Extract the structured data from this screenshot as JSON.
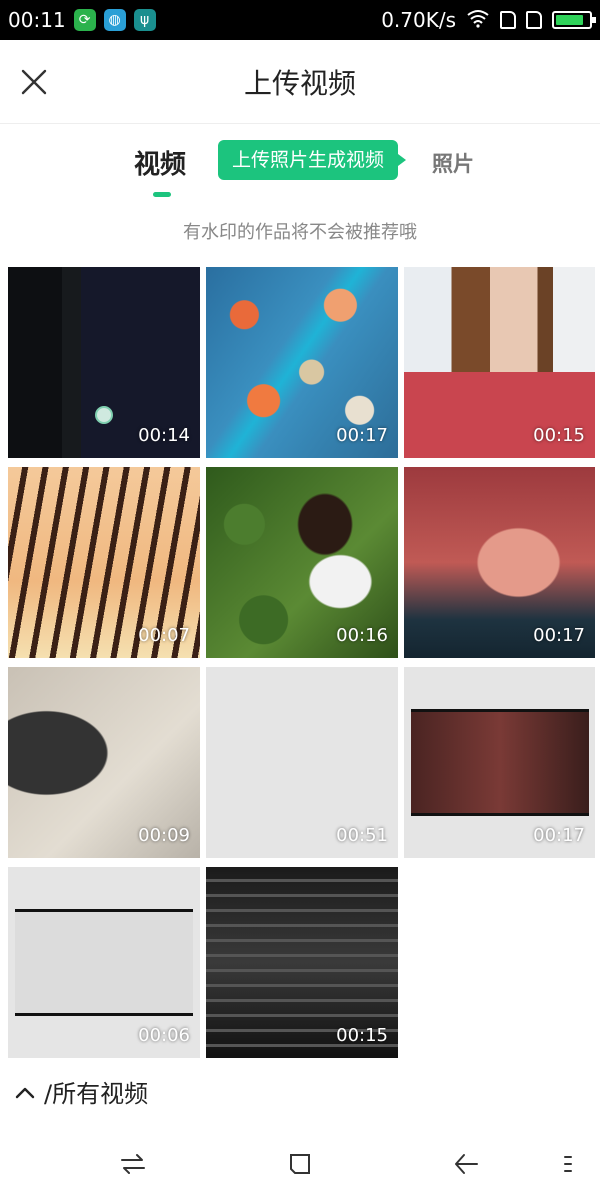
{
  "status_bar": {
    "time": "00:11",
    "network_speed": "0.70K/s",
    "battery_level": 0.85,
    "app_icons": [
      "sync-app-icon",
      "browser-app-icon",
      "usb-icon"
    ]
  },
  "header": {
    "title": "上传视频"
  },
  "tabs": {
    "video": "视频",
    "tip": "上传照片生成视频",
    "photo": "照片"
  },
  "notice": "有水印的作品将不会被推荐哦",
  "videos": [
    {
      "duration": "00:14"
    },
    {
      "duration": "00:17"
    },
    {
      "duration": "00:15"
    },
    {
      "duration": "00:07"
    },
    {
      "duration": "00:16"
    },
    {
      "duration": "00:17"
    },
    {
      "duration": "00:09"
    },
    {
      "duration": "00:51"
    },
    {
      "duration": "00:17"
    },
    {
      "duration": "00:06"
    },
    {
      "duration": "00:15"
    }
  ],
  "folder": {
    "label": "/所有视频"
  },
  "colors": {
    "accent": "#1cc47e",
    "status_bar_bg": "#000000"
  }
}
